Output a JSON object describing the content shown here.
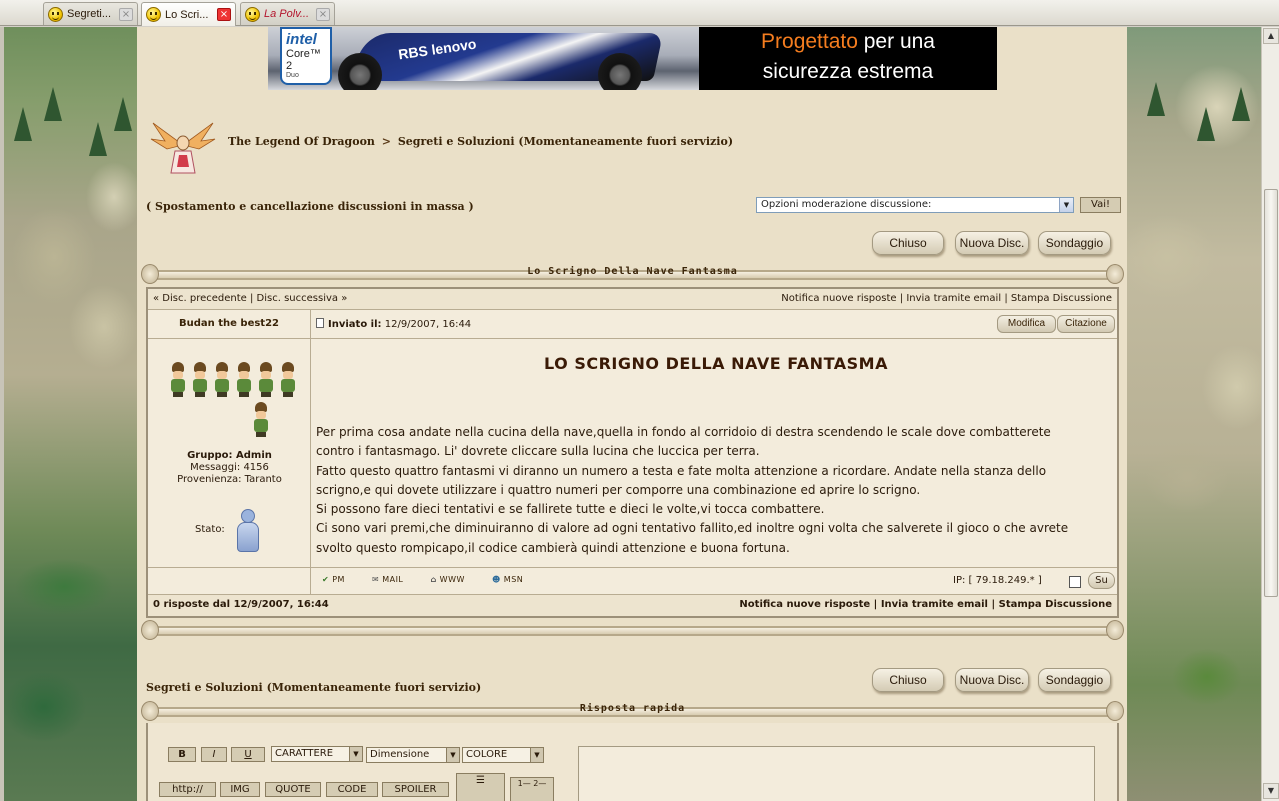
{
  "tabs": [
    {
      "label": "Segreti...",
      "active": false,
      "italic": false
    },
    {
      "label": "Lo Scri...",
      "active": true,
      "italic": false
    },
    {
      "label": "La Polv...",
      "active": false,
      "italic": true
    }
  ],
  "banner": {
    "intel_line1": "intel",
    "intel_line2": "Core™ 2",
    "intel_line3": "Duo",
    "car_text": "RBS  lenovo",
    "ad_line1_highlight": "Progettato",
    "ad_line1_rest": " per una",
    "ad_line2": "sicurezza estrema"
  },
  "breadcrumb": {
    "forum": "The Legend Of Dragoon",
    "separator": ">",
    "section": "Segreti e Soluzioni (Momentaneamente fuori servizio)"
  },
  "moderation": {
    "mass_move_label": "( Spostamento e cancellazione discussioni in massa )",
    "select_value": "Opzioni moderazione discussione:",
    "go_button": "Vai!"
  },
  "actions": {
    "closed": "Chiuso",
    "new_topic": "Nuova Disc.",
    "poll": "Sondaggio"
  },
  "topic": {
    "title": "Lo  Scrigno  Della  Nave  Fantasma",
    "prev": "« Disc. precedente",
    "next": "Disc. successiva »",
    "nav_sep": "|",
    "notify": "Notifica nuove risposte",
    "email": "Invia tramite email",
    "print": "Stampa Discussione"
  },
  "post": {
    "author": "Budan the best22",
    "sent_label": "Inviato il:",
    "sent_date": "12/9/2007, 16:44",
    "edit_button": "Modifica",
    "quote_button": "Citazione",
    "group": "Gruppo: Admin",
    "messages": "Messaggi: 4156",
    "origin": "Provenienza: Taranto",
    "status_label": "Stato:",
    "heading": "LO SCRIGNO DELLA NAVE FANTASMA",
    "lines": [
      "Per prima cosa andate nella cucina della nave,quella in fondo al corridoio di destra scendendo le scale dove combatterete",
      "contro i fantasmago. Li' dovrete cliccare sulla lucina che luccica per terra.",
      "Fatto questo quattro fantasmi vi diranno un numero a testa e fate molta attenzione a ricordare. Andate nella stanza dello",
      "scrigno,e qui dovete utilizzare i quattro numeri per comporre una combinazione ed aprire lo scrigno.",
      "Si possono fare dieci tentativi e se fallirete tutte e dieci le volte,vi tocca combattere.",
      "Ci sono vari premi,che diminuiranno di valore ad ogni tentativo fallito,ed inoltre ogni volta che salverete il gioco o che avrete",
      "svolto questo rompicapo,il codice cambierà quindi attenzione e buona fortuna."
    ],
    "contacts": [
      "PM",
      "MAIL",
      "WWW",
      "MSN"
    ],
    "ip": "IP: [ 79.18.249.* ]",
    "up_button": "Su"
  },
  "footer": {
    "replies": "0 risposte dal 12/9/2007, 16:44",
    "notify": "Notifica nuove risposte",
    "email": "Invia tramite email",
    "print": "Stampa Discussione",
    "sep": "|"
  },
  "section_label": "Segreti e Soluzioni (Momentaneamente fuori servizio)",
  "quick_reply": {
    "title": "Risposta rapida",
    "bold": "B",
    "italic": "I",
    "underline": "U",
    "font_select": "CARATTERE",
    "size_select": "Dimensione",
    "color_select": "COLORE",
    "http": "http://",
    "img": "IMG",
    "quote": "QUOTE",
    "code": "CODE",
    "spoiler": "SPOILER",
    "list_numbered": "1— 2—"
  }
}
